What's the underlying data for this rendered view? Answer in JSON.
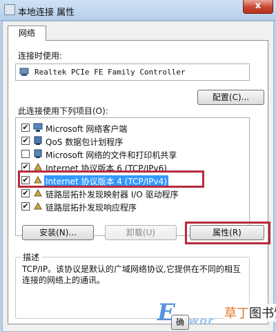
{
  "window": {
    "title": "本地连接 属性",
    "close_label": "x"
  },
  "tab": {
    "label": "网络"
  },
  "connect_using": {
    "label": "连接时使用:",
    "adapter": "Realtek PCIe FE Family Controller"
  },
  "configure_button": "配置(C)...",
  "items_label": "此连接使用下列项目(O):",
  "items": [
    {
      "label": "Microsoft 网络客户端",
      "checked": true,
      "icon": "network-client-icon"
    },
    {
      "label": "QoS 数据包计划程序",
      "checked": true,
      "icon": "qos-icon"
    },
    {
      "label": "Microsoft 网络的文件和打印机共享",
      "checked": false,
      "icon": "file-printer-sharing-icon"
    },
    {
      "label": "Internet 协议版本 6 (TCP/IPv6)",
      "checked": true,
      "icon": "protocol-icon"
    },
    {
      "label": "Internet 协议版本 4 (TCP/IPv4)",
      "checked": true,
      "icon": "protocol-icon",
      "selected": true
    },
    {
      "label": "链路层拓扑发现映射器 I/O 驱动程序",
      "checked": true,
      "icon": "protocol-icon"
    },
    {
      "label": "链路层拓扑发现响应程序",
      "checked": true,
      "icon": "protocol-icon"
    }
  ],
  "buttons": {
    "install": "安装(N)...",
    "uninstall": "卸载(U)",
    "properties": "属性(R)",
    "ok_partial": "确"
  },
  "description": {
    "title": "描述",
    "text": "TCP/IP。该协议是默认的广域网络协议,它提供在不同的相互连接的网络上的通讯。"
  },
  "watermark": {
    "letter": "E",
    "word": "vwor",
    "site_accent": "草丁",
    "site_rest": "图书馆"
  },
  "colors": {
    "highlight": "#b8293b",
    "selection": "#3399ff",
    "title_bar": "#b5cfe9"
  }
}
